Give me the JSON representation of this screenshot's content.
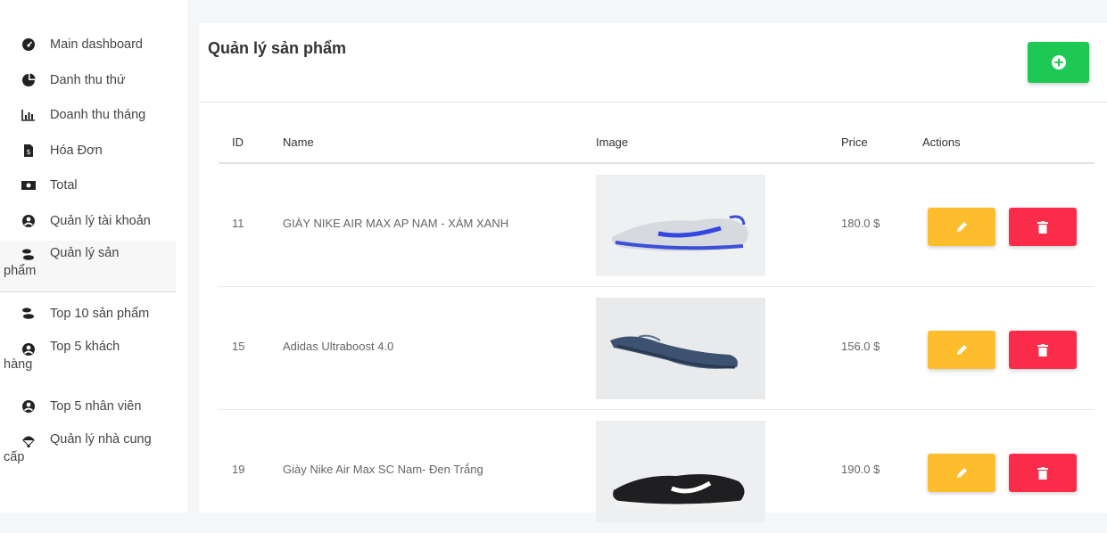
{
  "sidebar": {
    "items": [
      {
        "label": "Main dashboard",
        "icon": "dashboard-icon"
      },
      {
        "label": "Danh thu thứ",
        "icon": "pie-chart-icon"
      },
      {
        "label": "Doanh thu tháng",
        "icon": "bar-chart-icon"
      },
      {
        "label": "Hóa Đơn",
        "icon": "invoice-icon"
      },
      {
        "label": "Total",
        "icon": "money-icon"
      },
      {
        "label": "Quản lý tài khoản",
        "icon": "user-circle-icon"
      },
      {
        "label": "Quản lý sản",
        "label2": "phẩm",
        "icon": "shoe-icon"
      },
      {
        "label": "Top 10 sản phẩm",
        "icon": "shoe-icon"
      },
      {
        "label": "Top 5 khách",
        "label2": "hàng",
        "icon": "user-circle-icon"
      },
      {
        "label": "Top 5 nhân viên",
        "icon": "user-circle-icon"
      },
      {
        "label": "Quản lý nhà cung",
        "label2": "cấp",
        "icon": "parachute-icon"
      }
    ]
  },
  "main": {
    "title": "Quản lý sản phẩm",
    "add_icon": "plus-circle-icon",
    "columns": [
      "ID",
      "Name",
      "Image",
      "Price",
      "Actions"
    ],
    "rows": [
      {
        "id": "11",
        "name": "GIÀY NIKE AIR MAX AP NAM - XÁM XANH",
        "price": "180.0 $",
        "image": "grey-blue-sneaker"
      },
      {
        "id": "15",
        "name": "Adidas Ultraboost 4.0",
        "price": "156.0 $",
        "image": "navy-running-shoe"
      },
      {
        "id": "19",
        "name": "Giày Nike Air Max SC Nam- Đen Trắng",
        "price": "190.0 $",
        "image": "black-white-sneaker"
      }
    ]
  },
  "colors": {
    "add_button": "#1dc855",
    "edit_button": "#fdbd2c",
    "delete_button": "#fb2c4a"
  }
}
